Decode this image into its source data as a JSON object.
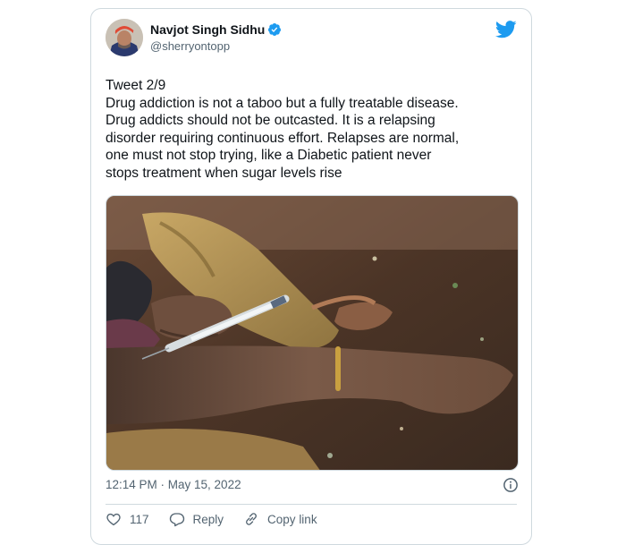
{
  "author": {
    "name": "Navjot Singh Sidhu",
    "handle": "@sherryontopp",
    "verified": true
  },
  "tweet": {
    "lines": [
      "Tweet 2/9",
      "Drug addiction is not a taboo but a fully treatable disease.",
      "Drug addicts should not be outcasted. It is a relapsing",
      "disorder requiring continuous effort. Relapses are normal,",
      "one must not stop trying, like a Diabetic patient never",
      "stops treatment when sugar levels rise"
    ],
    "timestamp": "12:14 PM · May 15, 2022"
  },
  "actions": {
    "like_count": "117",
    "reply_label": "Reply",
    "copy_link_label": "Copy link"
  },
  "colors": {
    "brand": "#1d9bf0",
    "text": "#0f1419",
    "secondary": "#536471",
    "border": "#cfd9de"
  },
  "icons": [
    "verified-badge-icon",
    "twitter-bird-icon",
    "info-icon",
    "heart-icon",
    "reply-icon",
    "link-icon"
  ]
}
